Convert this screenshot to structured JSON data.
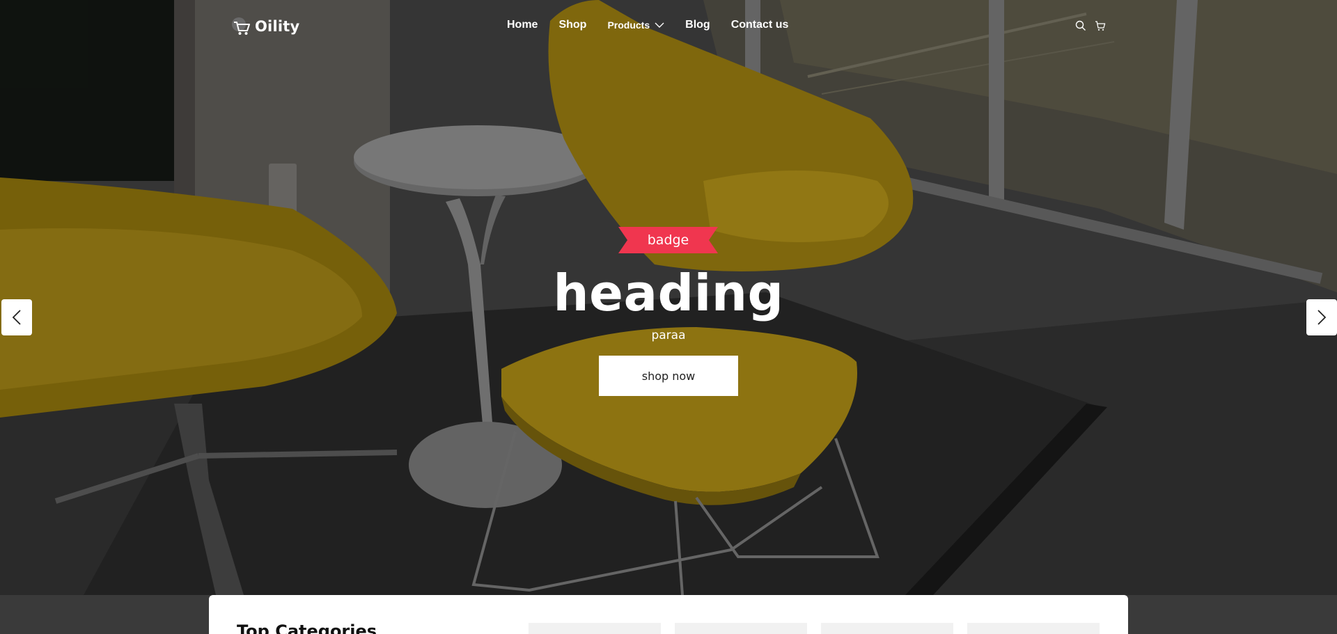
{
  "navbar": {
    "brand": "Oility",
    "links": [
      {
        "label": "Home"
      },
      {
        "label": "Shop"
      },
      {
        "label": "Products"
      },
      {
        "label": "Blog"
      },
      {
        "label": "Contact us"
      }
    ],
    "icons": [
      "search-icon",
      "cart-icon"
    ]
  },
  "hero": {
    "badge": "badge",
    "heading": "heading",
    "paragraph": "paraa",
    "button": "shop now",
    "colors": {
      "badge": "#f0364f",
      "overlay": "rgba(0,0,0,0.28)",
      "chair": "#c9a218"
    }
  },
  "slider": {
    "prev_icon": "chevron-left-icon",
    "next_icon": "chevron-right-icon"
  },
  "categories": {
    "title": "Top Categories"
  }
}
